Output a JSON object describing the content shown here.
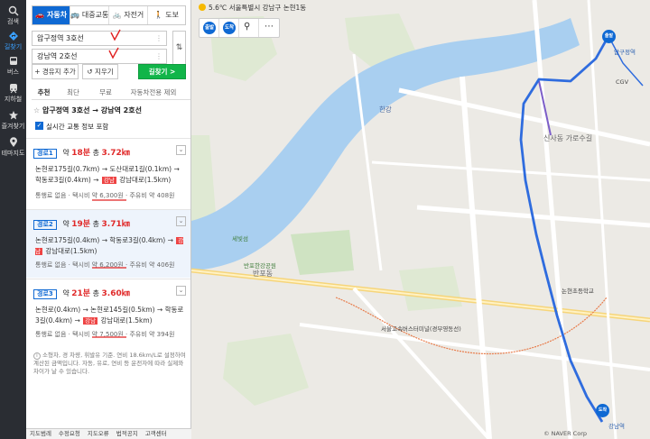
{
  "nav": {
    "items": [
      {
        "label": "검색",
        "icon": "search-icon"
      },
      {
        "label": "길찾기",
        "icon": "directions-icon"
      },
      {
        "label": "버스",
        "icon": "bus-icon"
      },
      {
        "label": "지하철",
        "icon": "subway-icon"
      },
      {
        "label": "즐겨찾기",
        "icon": "star-icon"
      },
      {
        "label": "테마지도",
        "icon": "pin-icon"
      }
    ]
  },
  "modes": [
    "자동차",
    "대중교통",
    "자전거",
    "도보"
  ],
  "start": {
    "value": "압구정역 3호선"
  },
  "goal": {
    "value": "강남역 2호선"
  },
  "buttons": {
    "waypoint": "+ 경유지 추가",
    "clear": "↺ 지우기",
    "go": "길찾기 >"
  },
  "options": [
    "추천",
    "최단",
    "무료",
    "자동차전용 제외"
  ],
  "summary": {
    "from": "압구정역 3호선",
    "arrow": "→",
    "to": "강남역 2호선"
  },
  "live": "실시간 교통 정보 포함",
  "routes": [
    {
      "tag": "경로1",
      "approx": "약",
      "time": "18분",
      "total": "총",
      "distance": "3.72㎞",
      "path_a": "논현로175길(0.7km) → 도산대로1길(0.1km) → 학동로3길(0.4km) →",
      "hw": "강남",
      "path_b": "강남대로(1.5km)",
      "fee": "통행료 없음 · 택시비 약 6,300원 · 주유비 약 408원"
    },
    {
      "tag": "경로2",
      "approx": "약",
      "time": "19분",
      "total": "총",
      "distance": "3.71㎞",
      "path_a": "논현로175길(0.4km) → 학동로3길(0.4km) →",
      "hw": "강남",
      "path_b": "강남대로(1.5km)",
      "fee": "통행료 없음 · 택시비 약 6,200원 · 주유비 약 406원"
    },
    {
      "tag": "경로3",
      "approx": "약",
      "time": "21분",
      "total": "총",
      "distance": "3.60㎞",
      "path_a": "논현로(0.4km) → 논현로145길(0.5km) → 학동로3길(0.4km) →",
      "hw": "강남",
      "path_b": "강남대로(1.5km)",
      "fee": "통행료 없음 · 택시비 약 7,500원 · 주유비 약 394원"
    }
  ],
  "note": "소형차, 경 차량, 휘발유 기준. 연비 18.6km/L로 설정하여 계산된 금액입니다. 자동, 유로, 연비 등 운전자에 따라 실제와 차이가 날 수 있습니다.",
  "bottom": [
    "지도범례",
    "수정요청",
    "지도오류",
    "법적공지",
    "고객센터"
  ],
  "weather": "5.6℃ 서울특별시 강남구 논현1동",
  "map": {
    "start_pin": "출발",
    "end_pin": "도착",
    "labels": {
      "river": "한강",
      "sebit": "세빛섬",
      "fountain": "반포한강공원",
      "apgujeong": "압구정역",
      "sinsa": "신사동 가로수길",
      "cgv": "CGV",
      "nonhyeon": "논현초등학교",
      "express": "서울고속버스터미널(경부영동선)",
      "gangnam": "강남역",
      "banpo": "반포동",
      "copyright": "© NAVER Corp"
    }
  },
  "colors": {
    "accent": "#0f69d3",
    "route": "#2f6cde",
    "go": "#11b549",
    "time": "#e02a2a"
  }
}
